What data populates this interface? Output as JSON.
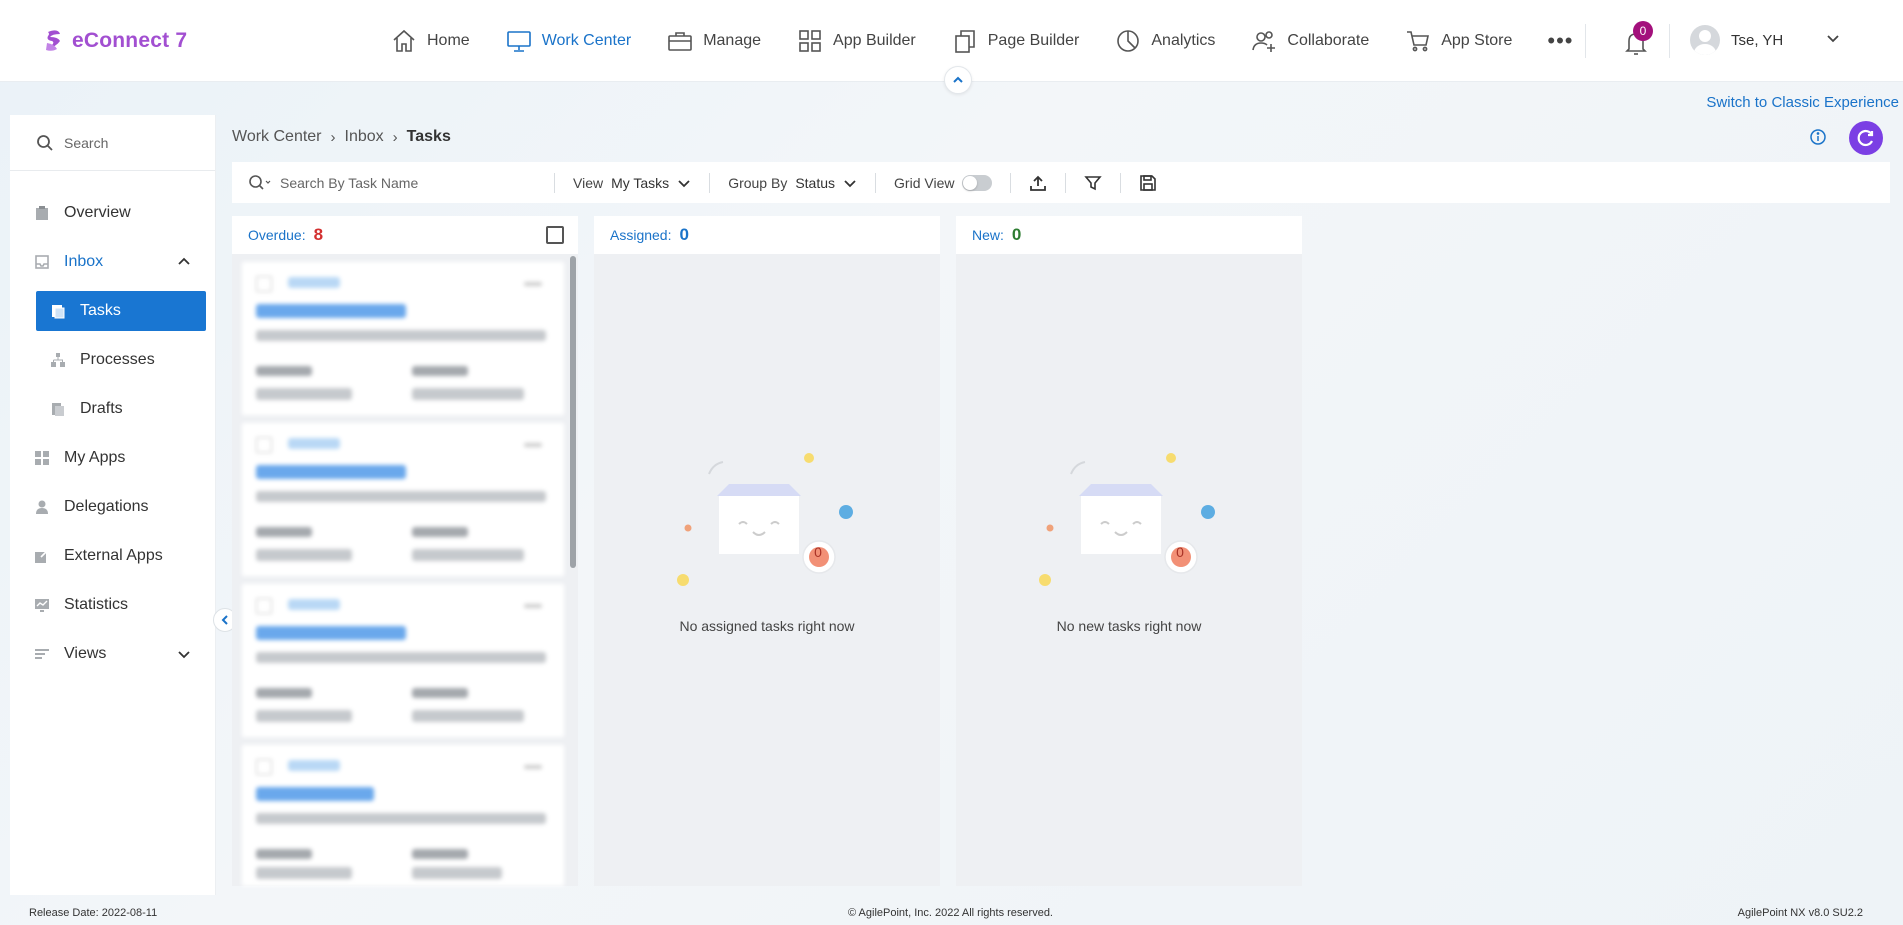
{
  "app": {
    "name": "eConnect 7",
    "brand_color": "#a24fd1",
    "accent_color": "#1a73c9"
  },
  "nav": {
    "items": [
      {
        "label": "Home",
        "icon": "home-icon",
        "active": false
      },
      {
        "label": "Work Center",
        "icon": "monitor-icon",
        "active": true
      },
      {
        "label": "Manage",
        "icon": "briefcase-icon",
        "active": false
      },
      {
        "label": "App Builder",
        "icon": "grid-icon",
        "active": false
      },
      {
        "label": "Page Builder",
        "icon": "pages-icon",
        "active": false
      },
      {
        "label": "Analytics",
        "icon": "pie-chart-icon",
        "active": false
      },
      {
        "label": "Collaborate",
        "icon": "users-icon",
        "active": false
      },
      {
        "label": "App Store",
        "icon": "cart-icon",
        "active": false
      }
    ],
    "more": "•••",
    "notifications_count": "0",
    "user_name": "Tse, YH"
  },
  "switch_classic": "Switch to Classic Experience",
  "sidebar": {
    "search_placeholder": "Search",
    "items": [
      {
        "label": "Overview",
        "icon": "clipboard-icon"
      },
      {
        "label": "Inbox",
        "icon": "inbox-icon",
        "expanded": true
      },
      {
        "label": "Tasks",
        "icon": "tasks-icon",
        "selected": true
      },
      {
        "label": "Processes",
        "icon": "sitemap-icon"
      },
      {
        "label": "Drafts",
        "icon": "drafts-icon"
      },
      {
        "label": "My Apps",
        "icon": "apps-grid-icon"
      },
      {
        "label": "Delegations",
        "icon": "person-icon"
      },
      {
        "label": "External Apps",
        "icon": "external-link-icon"
      },
      {
        "label": "Statistics",
        "icon": "statistics-icon"
      },
      {
        "label": "Views",
        "icon": "list-lines-icon",
        "expanded": false
      }
    ]
  },
  "breadcrumb": [
    "Work Center",
    "Inbox",
    "Tasks"
  ],
  "toolbar": {
    "search_placeholder": "Search By Task Name",
    "view_label": "View",
    "view_value": "My Tasks",
    "group_label": "Group By",
    "group_value": "Status",
    "grid_label": "Grid View",
    "grid_on": false
  },
  "columns": [
    {
      "label": "Overdue:",
      "count": "8",
      "count_color": "#d32f2f",
      "cards_visible": 4
    },
    {
      "label": "Assigned:",
      "count": "0",
      "count_color": "#1a73c9",
      "empty_message": "No assigned tasks right now",
      "badge": "0"
    },
    {
      "label": "New:",
      "count": "0",
      "count_color": "#2e7d32",
      "empty_message": "No new tasks right now",
      "badge": "0"
    }
  ],
  "footer": {
    "release": "Release Date: 2022-08-11",
    "copyright": "© AgilePoint, Inc. 2022 All rights reserved.",
    "version": "AgilePoint NX v8.0 SU2.2"
  }
}
